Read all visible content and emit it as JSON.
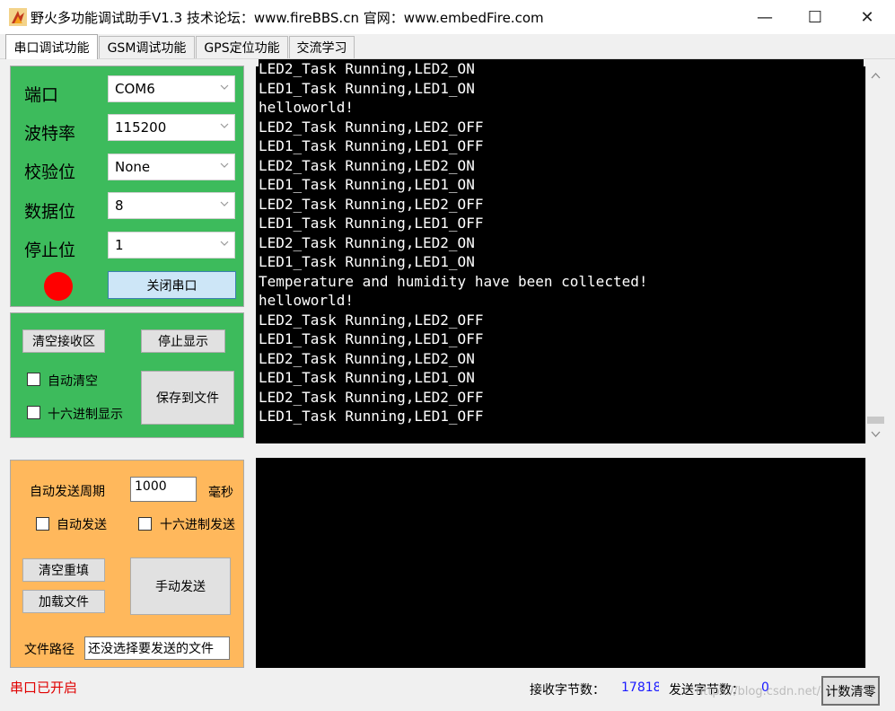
{
  "window": {
    "title": "野火多功能调试助手V1.3    技术论坛：www.fireBBS.cn    官网：www.embedFire.com",
    "min_glyph": "—",
    "max_glyph": "☐",
    "close_glyph": "✕"
  },
  "tabs": [
    "串口调试功能",
    "GSM调试功能",
    "GPS定位功能",
    "交流学习"
  ],
  "serial": {
    "port_label": "端口",
    "port_value": "COM6",
    "baud_label": "波特率",
    "baud_value": "115200",
    "parity_label": "校验位",
    "parity_value": "None",
    "databits_label": "数据位",
    "databits_value": "8",
    "stopbits_label": "停止位",
    "stopbits_value": "1",
    "status_color": "#ff0000",
    "close_port_label": "关闭串口"
  },
  "receive": {
    "clear_label": "清空接收区",
    "stop_display_label": "停止显示",
    "auto_clear_label": "自动清空",
    "hex_display_label": "十六进制显示",
    "save_file_label": "保存到文件",
    "lines": [
      "LED2_Task Running,LED2_ON",
      "LED1_Task Running,LED1_ON",
      "helloworld!",
      "LED2_Task Running,LED2_OFF",
      "LED1_Task Running,LED1_OFF",
      "LED2_Task Running,LED2_ON",
      "LED1_Task Running,LED1_ON",
      "LED2_Task Running,LED2_OFF",
      "LED1_Task Running,LED1_OFF",
      "LED2_Task Running,LED2_ON",
      "LED1_Task Running,LED1_ON",
      "Temperature and humidity have been collected!",
      "helloworld!",
      "LED2_Task Running,LED2_OFF",
      "LED1_Task Running,LED1_OFF",
      "LED2_Task Running,LED2_ON",
      "LED1_Task Running,LED1_ON",
      "LED2_Task Running,LED2_OFF",
      "LED1_Task Running,LED1_OFF"
    ]
  },
  "send": {
    "period_label": "自动发送周期",
    "period_value": "1000",
    "period_unit": "毫秒",
    "auto_send_label": "自动发送",
    "hex_send_label": "十六进制发送",
    "clear_refill_label": "清空重填",
    "load_file_label": "加载文件",
    "manual_send_label": "手动发送",
    "file_path_label": "文件路径",
    "file_path_value": "还没选择要发送的文件"
  },
  "status": {
    "port_status": "串口已开启",
    "port_status_color": "#e00000",
    "rx_label": "接收字节数：",
    "rx_value": "17818",
    "tx_label": "发送字节数：",
    "tx_value": "0",
    "reset_label": "计数清零",
    "watermark": "https://blog.csdn.net/qq_...c"
  }
}
